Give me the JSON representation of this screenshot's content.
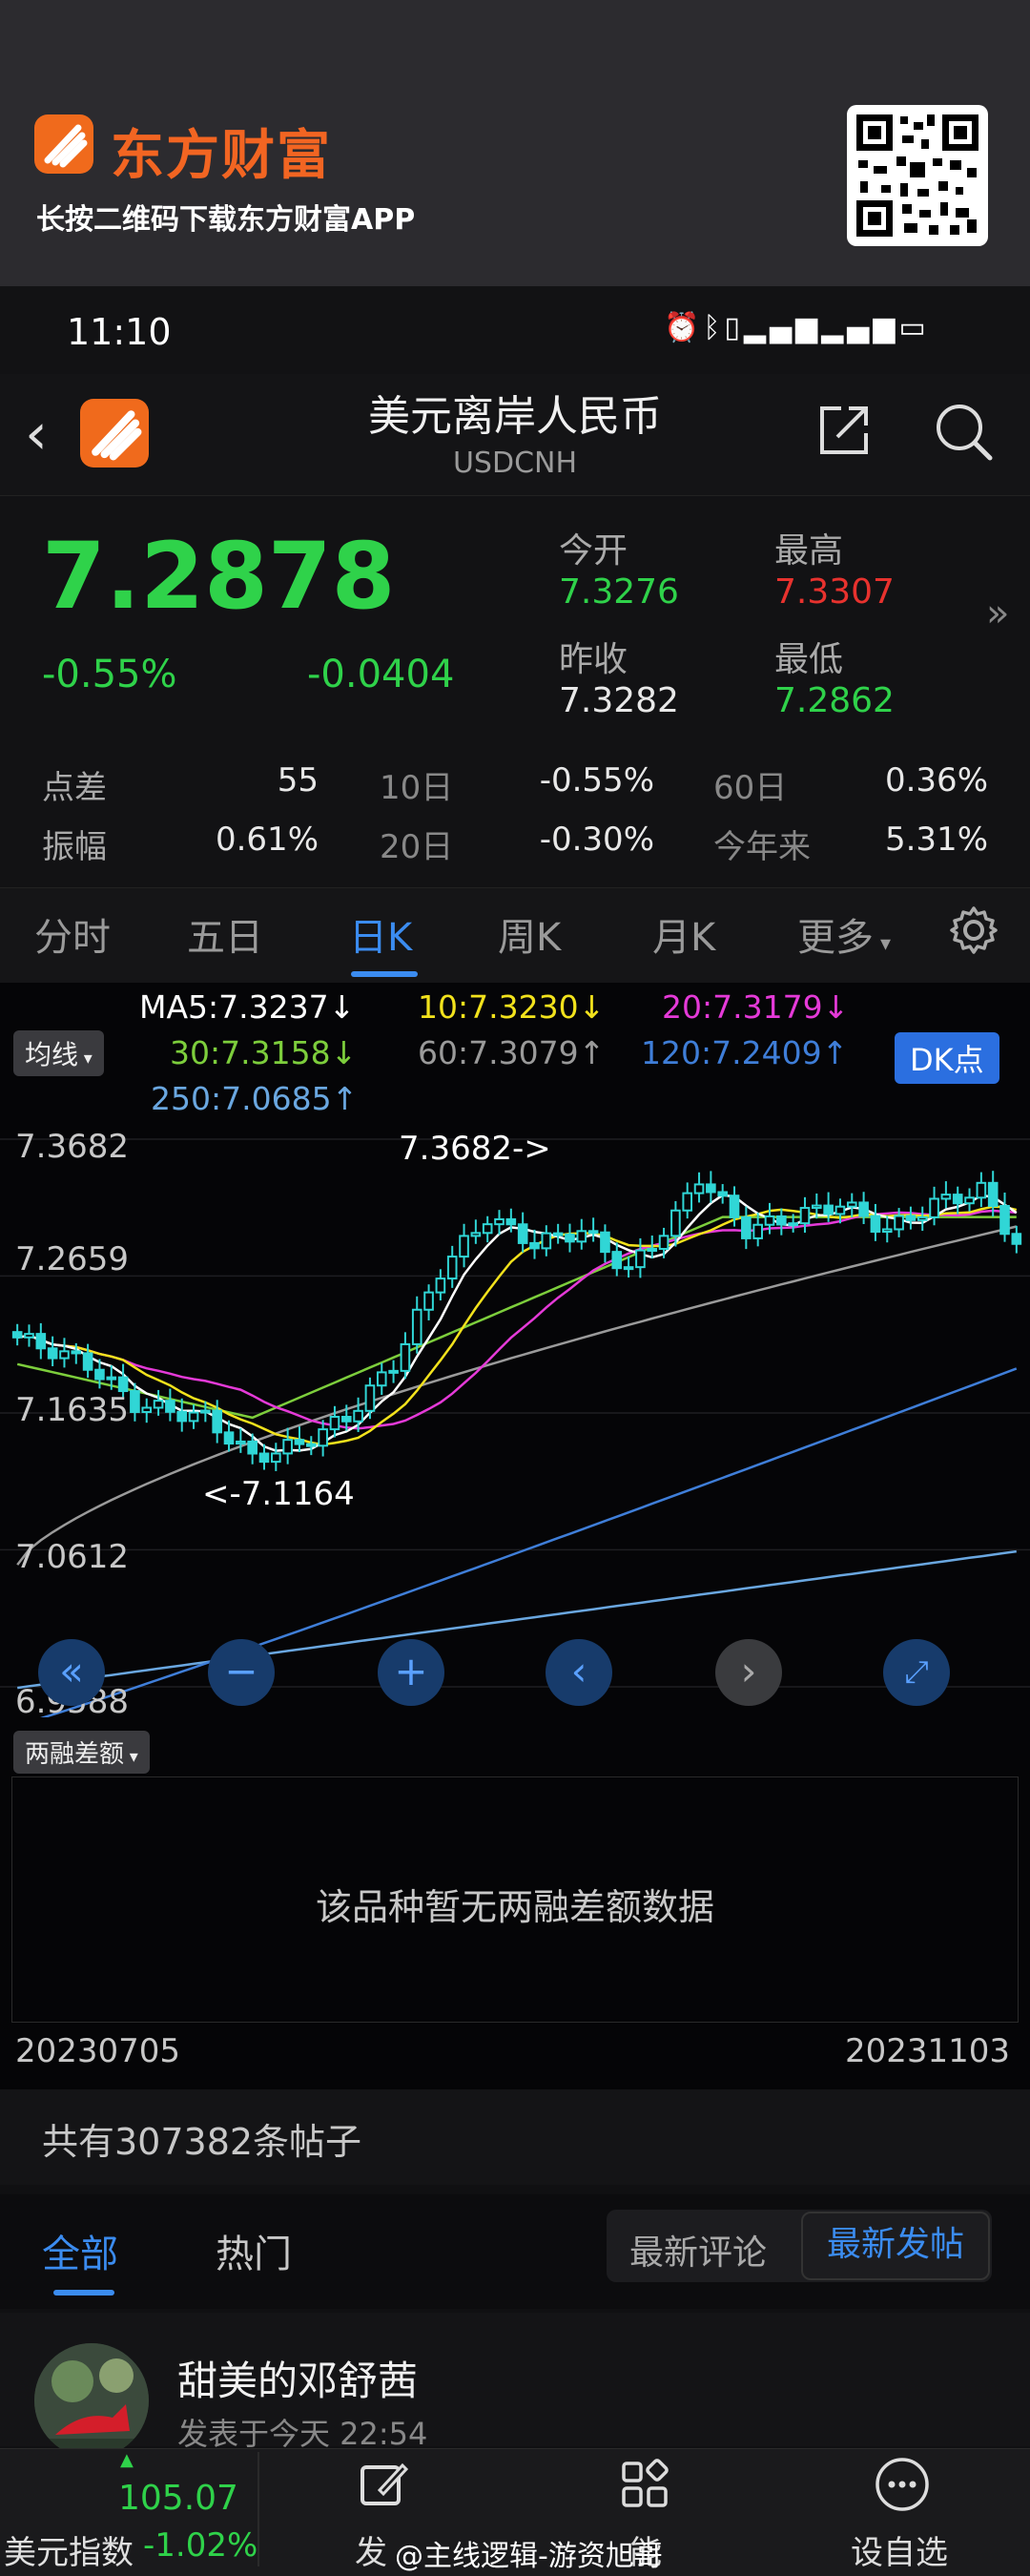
{
  "promo": {
    "brand": "东方财富",
    "tagline": "长按二维码下载东方财富APP"
  },
  "status_bar": {
    "time": "11:10",
    "icons": [
      "alarm-icon",
      "bluetooth-icon",
      "vibrate-icon",
      "5g-signal-icon",
      "4g-signal-icon",
      "battery-icon"
    ]
  },
  "header": {
    "title": "美元离岸人民币",
    "code": "USDCNH"
  },
  "quote": {
    "price": "7.2878",
    "change_pct": "-0.55%",
    "change": "-0.0404",
    "open_label": "今开",
    "open": "7.3276",
    "high_label": "最高",
    "high": "7.3307",
    "prev_close_label": "昨收",
    "prev_close": "7.3282",
    "low_label": "最低",
    "low": "7.2862"
  },
  "stats": [
    {
      "label": "点差",
      "value": "55"
    },
    {
      "label": "10日",
      "value": "-0.55%"
    },
    {
      "label": "60日",
      "value": "0.36%"
    },
    {
      "label": "振幅",
      "value": "0.61%"
    },
    {
      "label": "20日",
      "value": "-0.30%"
    },
    {
      "label": "今年来",
      "value": "5.31%"
    }
  ],
  "tabs": [
    "分时",
    "五日",
    "日K",
    "周K",
    "月K",
    "更多"
  ],
  "active_tab": "日K",
  "indicators": {
    "ma_selector": "均线",
    "ma5": "MA5:7.3237↓",
    "ma10": "10:7.3230↓",
    "ma20": "20:7.3179↓",
    "ma30": "30:7.3158↓",
    "ma60": "60:7.3079↑",
    "ma120": "120:7.2409↑",
    "ma250": "250:7.0685↑",
    "dk_button": "DK点",
    "colors": {
      "ma5": "#ffffff",
      "ma10": "#f2e21c",
      "ma20": "#e53ad8",
      "ma30": "#7dce3c",
      "ma60": "#9a9a9a",
      "ma120": "#3f7ed8",
      "ma250": "#6aa7e0",
      "candle_down": "#30d6d6"
    }
  },
  "chart_data": {
    "type": "candlestick",
    "y_ticks": [
      "7.3682",
      "7.2659",
      "7.1635",
      "7.0612",
      "6.9588"
    ],
    "ylim": [
      6.9588,
      7.3682
    ],
    "annotations": {
      "max_label": "7.3682->",
      "min_label": "<-7.1164"
    },
    "x_start": "20230705",
    "x_end": "20231103"
  },
  "chart_controls": [
    "rewind-icon",
    "zoom-out-icon",
    "zoom-in-icon",
    "scroll-left-icon",
    "scroll-right-icon",
    "fullscreen-icon"
  ],
  "margin_panel": {
    "selector": "两融差额",
    "empty_message": "该品种暂无两融差额数据"
  },
  "posts": {
    "count_text": "共有307382条帖子",
    "tab_all": "全部",
    "tab_hot": "热门",
    "sort_latest_comment": "最新评论",
    "sort_latest_post": "最新发帖",
    "item": {
      "username": "甜美的邓舒茜",
      "time": "发表于今天 22:54"
    }
  },
  "bottom_bar": {
    "index_value": "105.07",
    "index_name": "美元指数",
    "index_change": "-1.02%",
    "items": [
      {
        "label": "发",
        "icon": "edit-icon"
      },
      {
        "label": "能",
        "icon": "apps-icon"
      },
      {
        "label": "设自选",
        "icon": "more-icon"
      }
    ],
    "watermark": "@主线逻辑-游资旭哥"
  }
}
